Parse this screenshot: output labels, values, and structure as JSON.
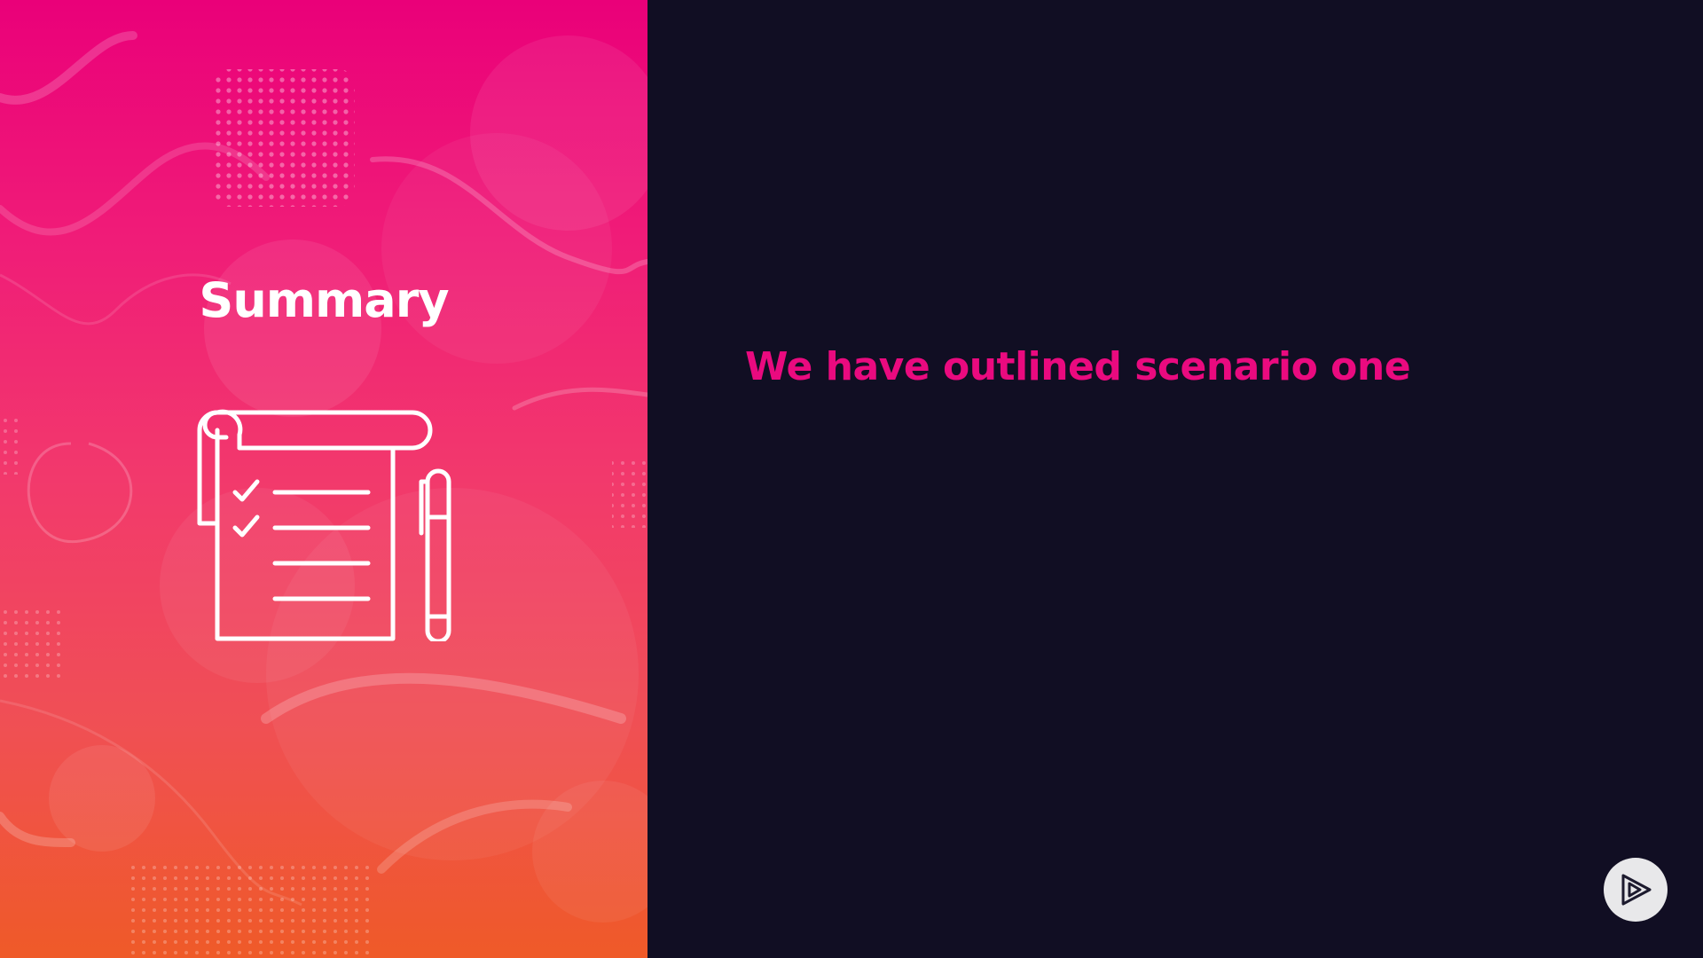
{
  "slide": {
    "section_title": "Summary",
    "headline": "We have outlined scenario one"
  },
  "icons": {
    "checklist": "checklist-notepad-icon",
    "pen": "pen-icon",
    "player_logo": "play-logo-icon"
  },
  "colors": {
    "background": "#110e23",
    "accent": "#ea0a7f",
    "gradient_top": "#ea0079",
    "gradient_bottom": "#ef5a28"
  }
}
